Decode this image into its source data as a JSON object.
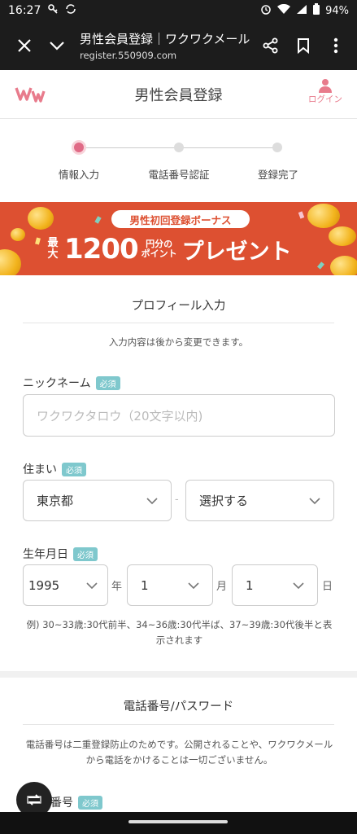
{
  "status": {
    "time": "16:27",
    "battery": "94%"
  },
  "browser": {
    "tab_title": "男性会員登録｜ワクワクメール",
    "url": "register.550909.com"
  },
  "header": {
    "title": "男性会員登録",
    "login_label": "ログイン"
  },
  "steps": [
    {
      "label": "情報入力",
      "active": true
    },
    {
      "label": "電話番号認証",
      "active": false
    },
    {
      "label": "登録完了",
      "active": false
    }
  ],
  "banner": {
    "badge": "男性初回登録ボーナス",
    "max": "最大",
    "amount": "1200",
    "unit_top": "円分の",
    "unit_bottom": "ポイント",
    "present": "プレゼント"
  },
  "profile": {
    "title": "プロフィール入力",
    "note": "入力内容は後から変更できます。",
    "nickname_label": "ニックネーム",
    "required": "必須",
    "nickname_placeholder": "ワクワクタロウ（20文字以内)",
    "residence_label": "住まい",
    "prefecture": "東京都",
    "city": "選択する",
    "birthday_label": "生年月日",
    "year": "1995",
    "year_unit": "年",
    "month": "1",
    "month_unit": "月",
    "day": "1",
    "day_unit": "日",
    "example": "例) 30~33歳:30代前半、34~36歳:30代半ば、37~39歳:30代後半と表示されます"
  },
  "phone_section": {
    "title": "電話番号/パスワード",
    "note": "電話番号は二重登録防止のためです。公開されることや、ワクワクメールから電話をかけることは一切ございません。",
    "phone_label": "番号",
    "required": "必須"
  },
  "colors": {
    "accent": "#e06a86",
    "banner": "#dd5031",
    "required_badge": "#7fc8cd"
  }
}
